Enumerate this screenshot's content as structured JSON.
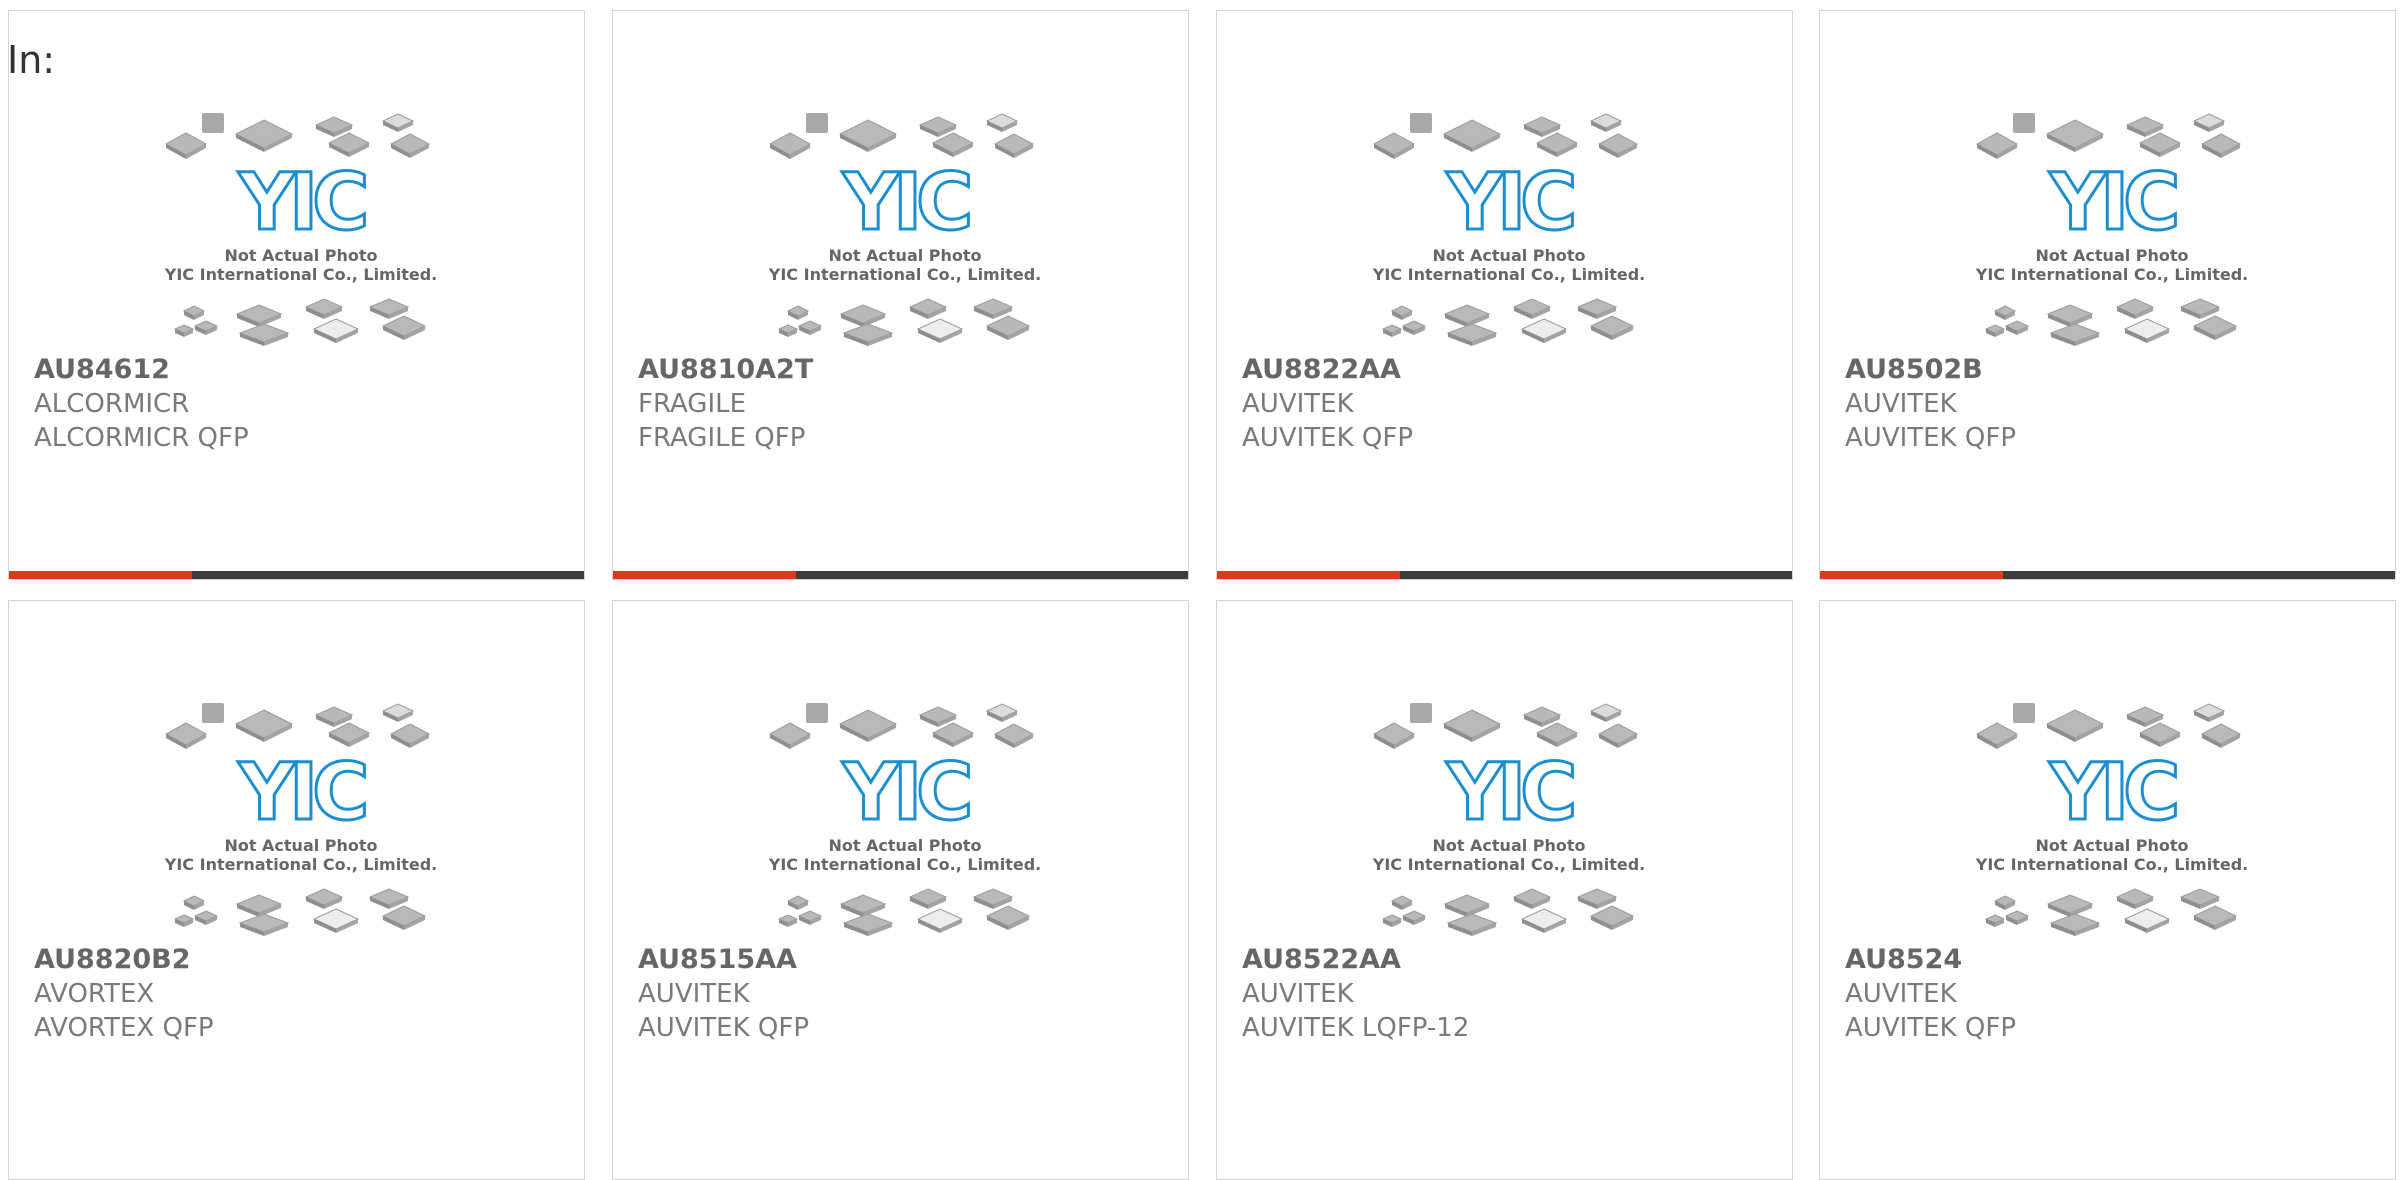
{
  "filter_label": "In:",
  "image_caption": {
    "line1": "Not Actual Photo",
    "line2": "YIC International Co., Limited.",
    "logo_text": "YIC"
  },
  "colors": {
    "accent": "#e0371d",
    "bar": "#3c3c3c",
    "logo_blue": "#1d8fd0",
    "text": "#666666"
  },
  "products": [
    {
      "part": "AU84612",
      "manufacturer": "ALCORMICR",
      "package": "ALCORMICR QFP"
    },
    {
      "part": "AU8810A2T",
      "manufacturer": "FRAGILE",
      "package": "FRAGILE QFP"
    },
    {
      "part": "AU8822AA",
      "manufacturer": "AUVITEK",
      "package": "AUVITEK QFP"
    },
    {
      "part": "AU8502B",
      "manufacturer": "AUVITEK",
      "package": "AUVITEK QFP"
    },
    {
      "part": "AU8820B2",
      "manufacturer": "AVORTEX",
      "package": "AVORTEX QFP"
    },
    {
      "part": "AU8515AA",
      "manufacturer": "AUVITEK",
      "package": "AUVITEK QFP"
    },
    {
      "part": "AU8522AA",
      "manufacturer": "AUVITEK",
      "package": "AUVITEK LQFP-12"
    },
    {
      "part": "AU8524",
      "manufacturer": "AUVITEK",
      "package": "AUVITEK QFP"
    }
  ]
}
